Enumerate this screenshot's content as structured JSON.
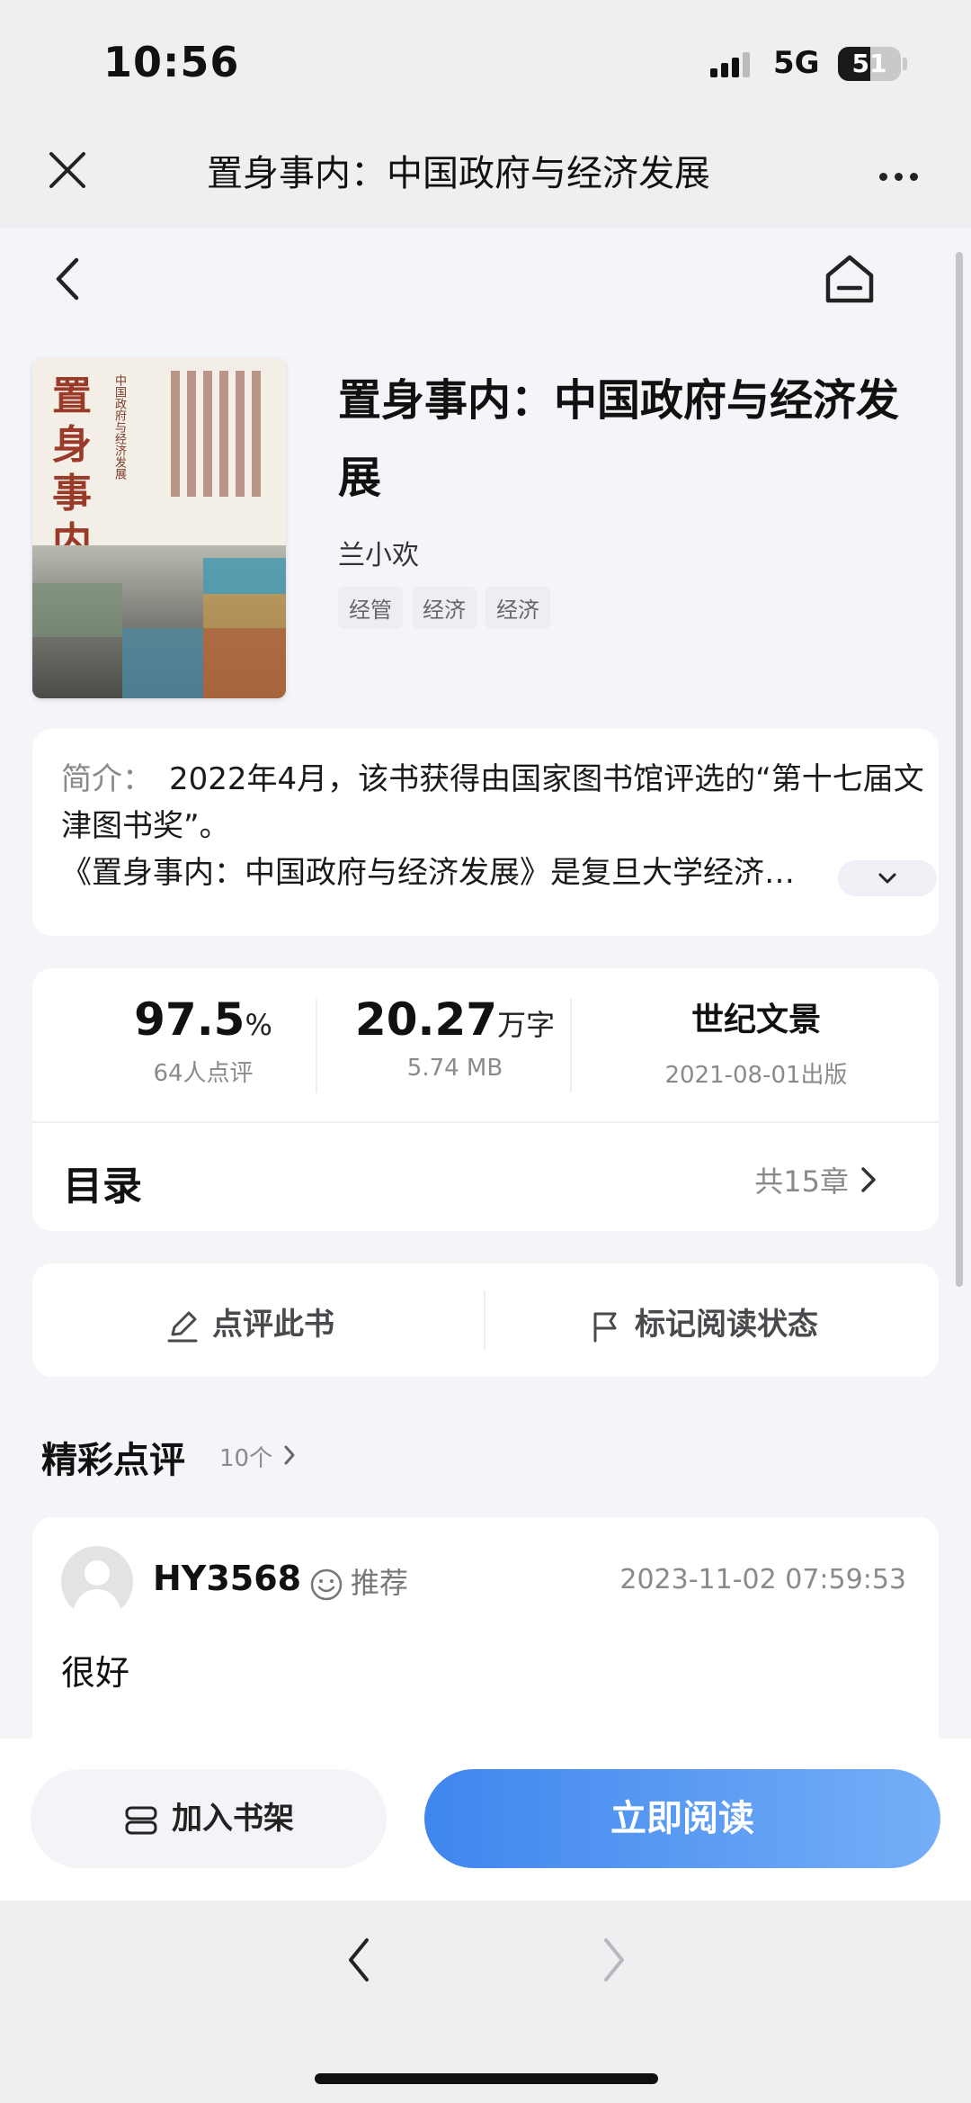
{
  "status_bar": {
    "time": "10:56",
    "network": "5G",
    "battery": "51"
  },
  "top_nav": {
    "title": "置身事内：中国政府与经济发展"
  },
  "book": {
    "cover_title": "置身事内",
    "cover_subtitle": "中国政府与经济发展",
    "title": "置身事内：中国政府与经济发展",
    "author": "兰小欢",
    "tags": [
      "经管",
      "经济",
      "经济"
    ]
  },
  "intro": {
    "label": "简介：",
    "line1": "2022年4月，该书获得由国家图书馆评选的“第十七届文津图书奖”。",
    "line2": "《置身事内：中国政府与经济发展》是复旦大学经济…"
  },
  "stats": {
    "rating_value": "97.5",
    "rating_unit": "%",
    "rating_sub": "64人点评",
    "words_value": "20.27",
    "words_unit": "万字",
    "words_sub": "5.74 MB",
    "publisher": "世纪文景",
    "publish_date": "2021-08-01出版"
  },
  "toc": {
    "label": "目录",
    "count": "共15章"
  },
  "actions": {
    "review": "点评此书",
    "mark": "标记阅读状态"
  },
  "reviews_section": {
    "title": "精彩点评",
    "count": "10个"
  },
  "review": {
    "user": "HY3568",
    "badge": "推荐",
    "date": "2023-11-02 07:59:53",
    "text": "很好"
  },
  "bottom": {
    "shelf": "加入书架",
    "read": "立即阅读"
  },
  "colors": {
    "primary_button": "#4a8ff0",
    "background": "#f4f5f9"
  }
}
